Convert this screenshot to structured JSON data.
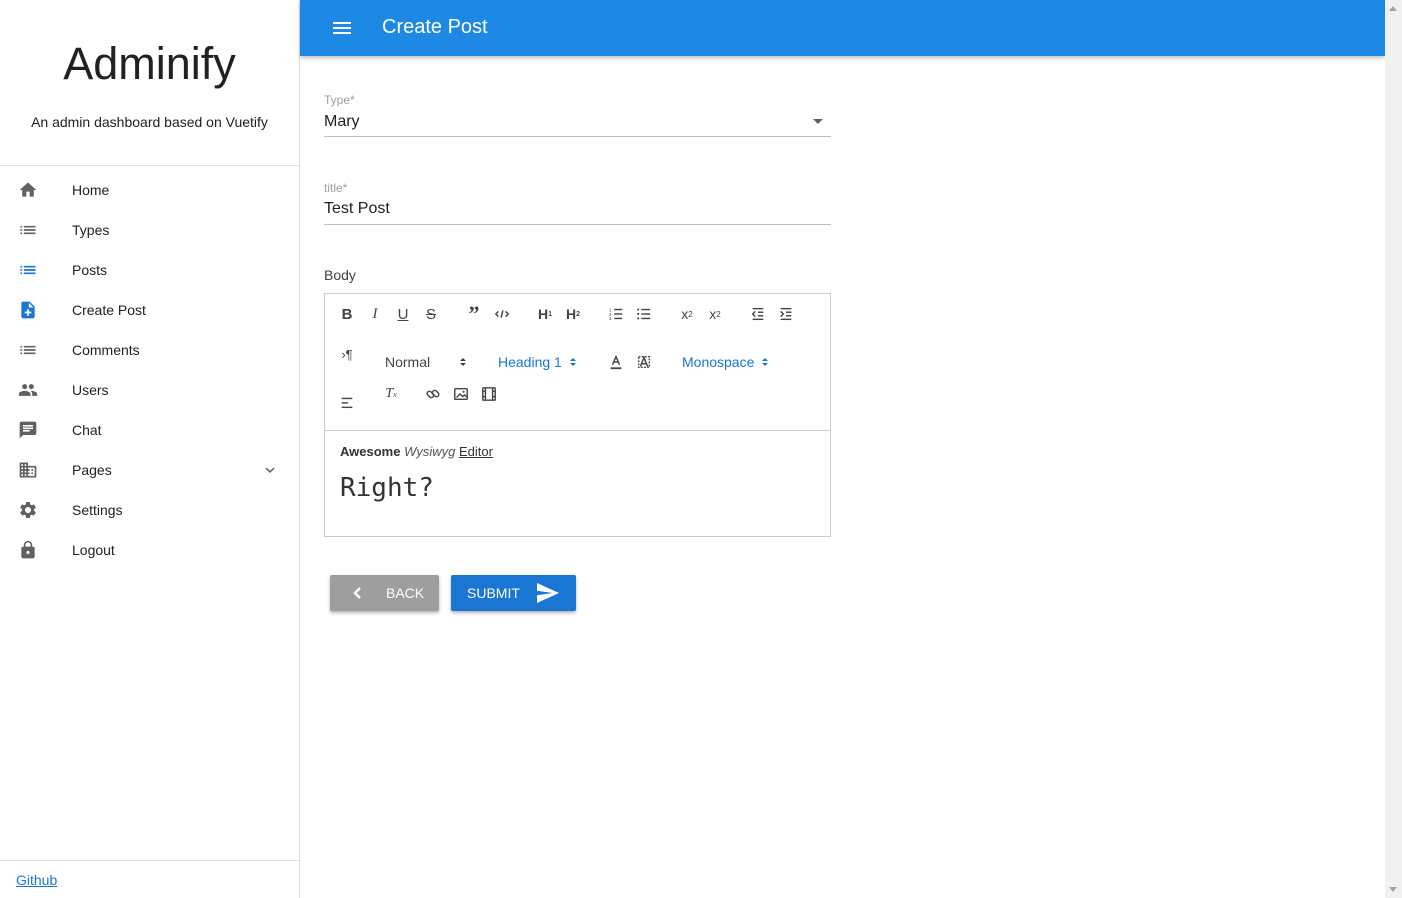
{
  "sidebar": {
    "brand_title": "Adminify",
    "brand_subtitle": "An admin dashboard based on Vuetify",
    "items": [
      {
        "label": "Home",
        "icon": "home-icon"
      },
      {
        "label": "Types",
        "icon": "list-icon"
      },
      {
        "label": "Posts",
        "icon": "list-icon"
      },
      {
        "label": "Create Post",
        "icon": "note-add-icon"
      },
      {
        "label": "Comments",
        "icon": "list-icon"
      },
      {
        "label": "Users",
        "icon": "people-icon"
      },
      {
        "label": "Chat",
        "icon": "chat-icon"
      },
      {
        "label": "Pages",
        "icon": "domain-icon"
      },
      {
        "label": "Settings",
        "icon": "gear-icon"
      },
      {
        "label": "Logout",
        "icon": "lock-icon"
      }
    ],
    "active_item": "Posts",
    "footer_link": "Github"
  },
  "toolbar": {
    "title": "Create Post"
  },
  "form": {
    "type_label": "Type*",
    "type_value": "Mary",
    "title_label": "title*",
    "title_value": "Test Post",
    "body_label": "Body"
  },
  "editor": {
    "header_picker": "Normal",
    "size_picker": "Heading 1",
    "font_picker": "Monospace",
    "content": {
      "bold": "Awesome",
      "italic": "Wysiwyg",
      "underline": "Editor",
      "mono": "Right?"
    }
  },
  "buttons": {
    "back_label": "BACK",
    "submit_label": "SUBMIT"
  },
  "colors": {
    "primary": "#1e88e5",
    "active_icon": "#1976d2",
    "back_button": "#9e9e9e"
  }
}
